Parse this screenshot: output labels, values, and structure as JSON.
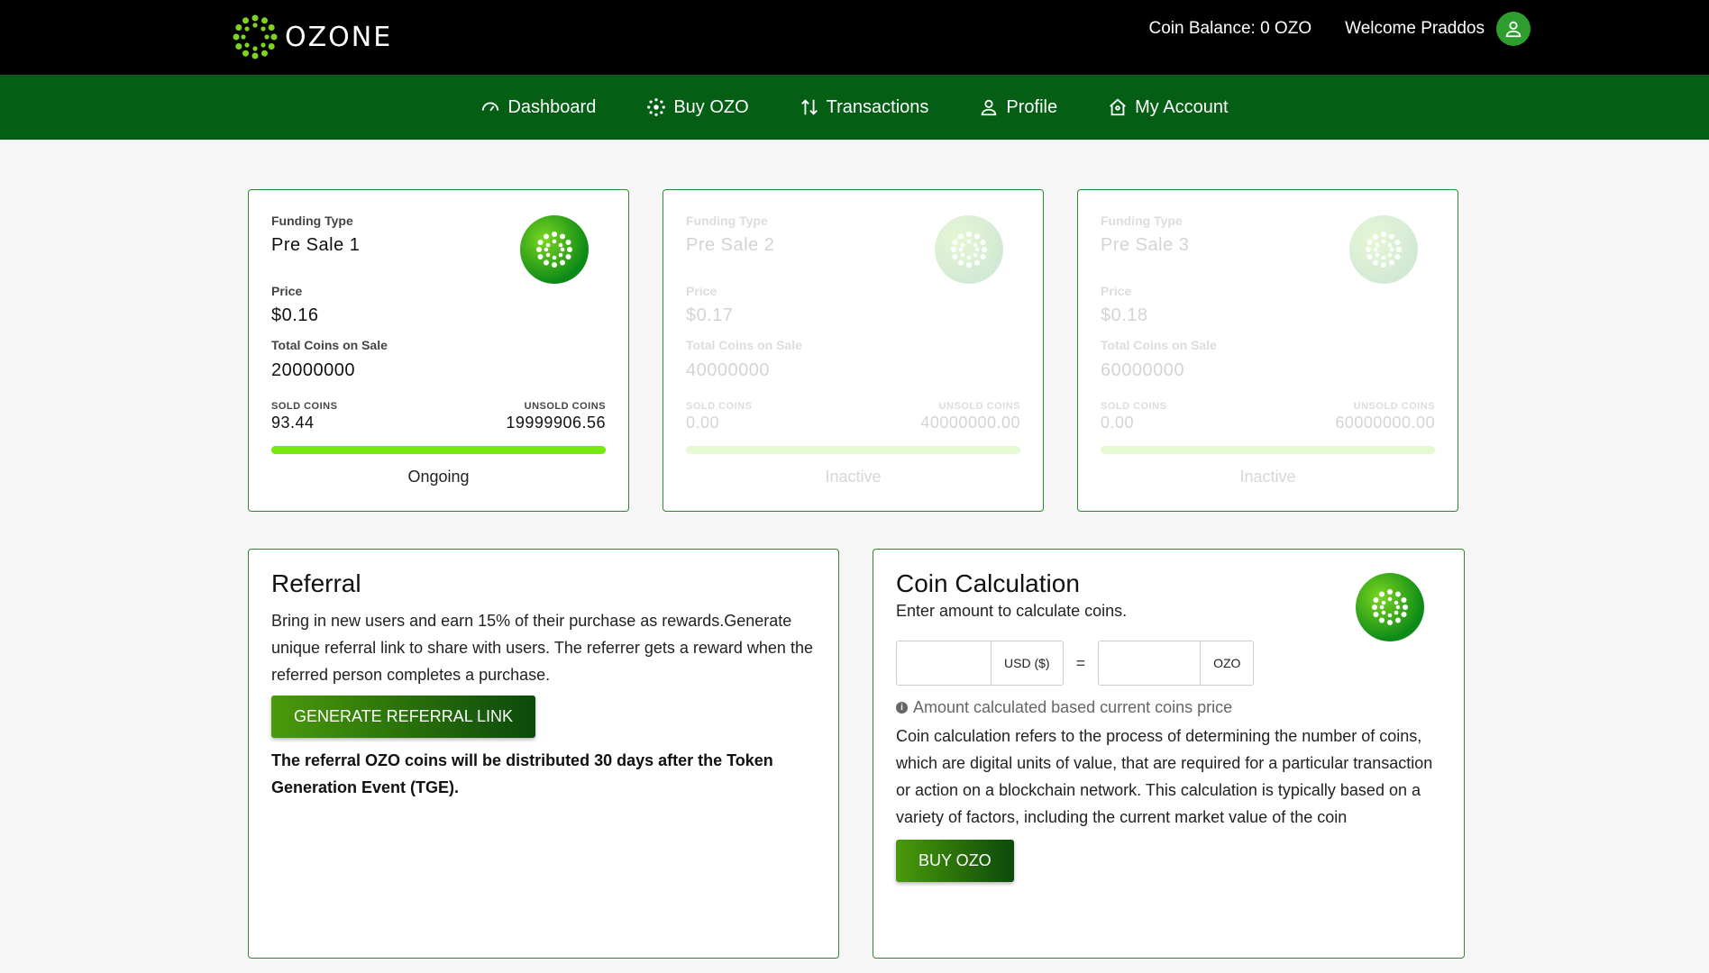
{
  "header": {
    "logo_text": "OZONE",
    "coin_balance": "Coin Balance: 0 OZO",
    "welcome": "Welcome Praddos"
  },
  "nav": {
    "items": [
      {
        "label": "Dashboard",
        "icon": "speedometer-icon"
      },
      {
        "label": "Buy OZO",
        "icon": "coin-icon"
      },
      {
        "label": "Transactions",
        "icon": "transfer-arrows-icon"
      },
      {
        "label": "Profile",
        "icon": "user-icon"
      },
      {
        "label": "My Account",
        "icon": "home-user-icon"
      }
    ]
  },
  "sales": [
    {
      "funding_type_label": "Funding Type",
      "name": "Pre Sale 1",
      "price_label": "Price",
      "price": "$0.16",
      "total_label": "Total Coins on Sale",
      "total": "20000000",
      "sold_label": "SOLD COINS",
      "sold": "93.44",
      "unsold_label": "UNSOLD COINS",
      "unsold": "19999906.56",
      "progress_fraction": 1,
      "status": "Ongoing",
      "active": true
    },
    {
      "funding_type_label": "Funding Type",
      "name": "Pre Sale 2",
      "price_label": "Price",
      "price": "$0.17",
      "total_label": "Total Coins on Sale",
      "total": "40000000",
      "sold_label": "SOLD COINS",
      "sold": "0.00",
      "unsold_label": "UNSOLD COINS",
      "unsold": "40000000.00",
      "progress_fraction": 1,
      "status": "Inactive",
      "active": false
    },
    {
      "funding_type_label": "Funding Type",
      "name": "Pre Sale 3",
      "price_label": "Price",
      "price": "$0.18",
      "total_label": "Total Coins on Sale",
      "total": "60000000",
      "sold_label": "SOLD COINS",
      "sold": "0.00",
      "unsold_label": "UNSOLD COINS",
      "unsold": "60000000.00",
      "progress_fraction": 1,
      "status": "Inactive",
      "active": false
    }
  ],
  "referral": {
    "title": "Referral",
    "description": "Bring in new users and earn 15% of their purchase as rewards.Generate unique referral link to share with users. The referrer gets a reward when the referred person completes a purchase.",
    "button": "GENERATE REFERRAL LINK",
    "note": "The referral OZO coins will be distributed 30 days after the Token Generation Event (TGE)."
  },
  "calc": {
    "title": "Coin Calculation",
    "subtitle": "Enter amount to calculate coins.",
    "usd_value": "",
    "usd_suffix": "USD ($)",
    "equals": "=",
    "ozo_value": "",
    "ozo_suffix": "OZO",
    "hint": "Amount calculated based current coins price",
    "description": "Coin calculation refers to the process of determining the number of coins, which are digital units of value, that are required for a particular transaction or action on a blockchain network. This calculation is typically based on a variety of factors, including the current market value of the coin",
    "button": "BUY OZO"
  },
  "colors": {
    "topbar": "#000000",
    "navbar": "#045e14",
    "accent": "#2b8a2b",
    "progress": "#76e90f"
  }
}
